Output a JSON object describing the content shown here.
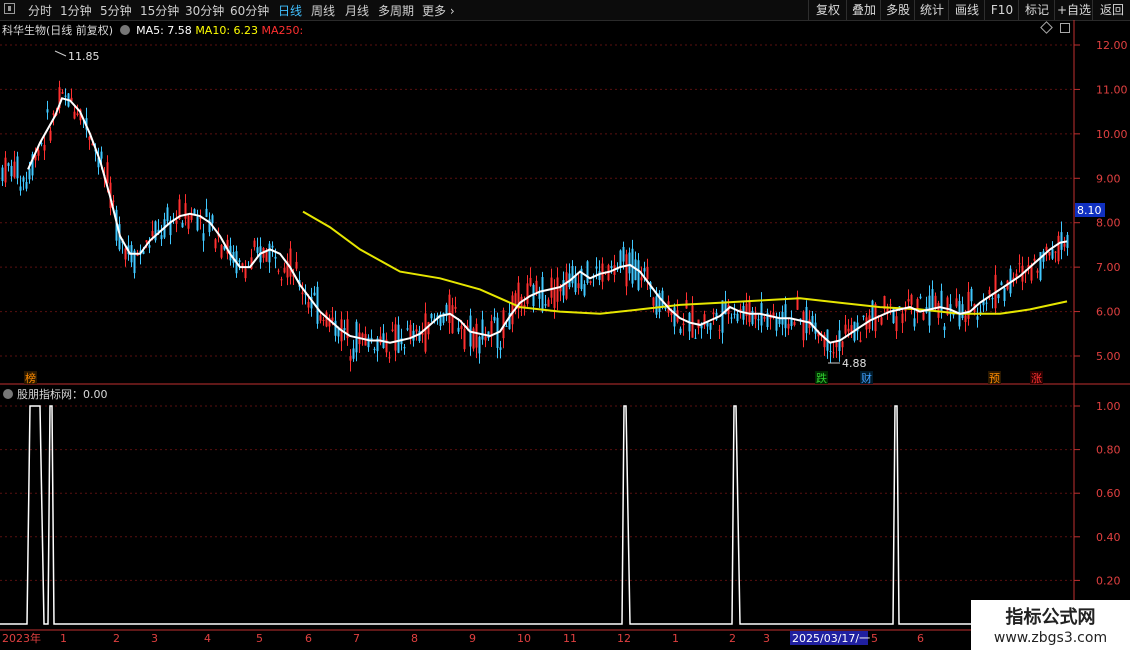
{
  "toolbar": {
    "periods": [
      "分时",
      "1分钟",
      "5分钟",
      "15分钟",
      "30分钟",
      "60分钟",
      "日线",
      "周线",
      "月线",
      "多周期",
      "更多"
    ],
    "active_period": "日线",
    "right_buttons": [
      "复权",
      "叠加",
      "多股",
      "统计",
      "画线",
      "F10",
      "标记",
      "+自选",
      "返回"
    ]
  },
  "main_panel": {
    "stock_title": "科华生物(日线 前复权)",
    "ma5_label": "MA5: 7.58",
    "ma10_label": "MA10: 6.23",
    "ma250_label": "MA250:",
    "colors": {
      "ma5": "#ffffff",
      "ma10": "#ffff00",
      "ma250": "#ff3030",
      "up": "#ff3030",
      "down": "#40c8ff"
    },
    "current_price_tag": "8.10",
    "high_annotation": "11.85",
    "low_annotation": "4.88",
    "event_markers": [
      {
        "text": "榜",
        "color": "#ff8c00"
      },
      {
        "text": "跌",
        "color": "#30d030"
      },
      {
        "text": "财",
        "color": "#40a0ff"
      },
      {
        "text": "预",
        "color": "#ff8c00"
      },
      {
        "text": "涨",
        "color": "#ff3030"
      }
    ]
  },
  "indicator_panel": {
    "title": "股朋指标网：0.00",
    "spike_count": 5
  },
  "time_axis": {
    "labels": [
      "2023年",
      "1",
      "2",
      "3",
      "4",
      "5",
      "6",
      "7",
      "8",
      "9",
      "10",
      "11",
      "12",
      "1",
      "2",
      "3",
      "2025/03/17/一",
      "5",
      "6"
    ]
  },
  "watermark": {
    "line1": "指标公式网",
    "line2": "www.zbgs3.com"
  },
  "chart_data": [
    {
      "type": "candlestick",
      "title": "科华生物(日线 前复权)",
      "ylim": [
        4.5,
        12.5
      ],
      "y_ticks": [
        "12.00",
        "11.00",
        "10.00",
        "9.00",
        "8.00",
        "7.00",
        "6.00",
        "5.00"
      ],
      "y_tick_values": [
        12,
        11,
        10,
        9,
        8,
        7,
        6,
        5
      ],
      "series": [
        {
          "name": "MA5",
          "x": [
            28,
            40,
            55,
            62,
            70,
            80,
            90,
            100,
            110,
            120,
            130,
            140,
            150,
            160,
            170,
            180,
            190,
            200,
            210,
            220,
            230,
            240,
            250,
            260,
            270,
            280,
            290,
            300,
            310,
            320,
            330,
            340,
            350,
            360,
            370,
            380,
            390,
            400,
            410,
            420,
            430,
            440,
            450,
            460,
            470,
            480,
            490,
            500,
            510,
            520,
            530,
            540,
            550,
            560,
            570,
            580,
            590,
            600,
            610,
            620,
            630,
            640,
            650,
            660,
            670,
            680,
            690,
            700,
            710,
            720,
            730,
            740,
            750,
            760,
            770,
            780,
            790,
            800,
            810,
            820,
            830,
            840,
            850,
            860,
            870,
            880,
            890,
            900,
            910,
            920,
            930,
            940,
            950,
            960,
            970,
            980,
            990,
            1000,
            1010,
            1020,
            1030,
            1040,
            1050,
            1060,
            1067
          ],
          "values": [
            9.2,
            9.8,
            10.4,
            10.8,
            10.75,
            10.5,
            10.0,
            9.4,
            8.6,
            7.7,
            7.3,
            7.3,
            7.6,
            7.8,
            8.0,
            8.15,
            8.2,
            8.15,
            8.0,
            7.7,
            7.3,
            7.0,
            7.0,
            7.3,
            7.4,
            7.3,
            7.0,
            6.6,
            6.3,
            6.0,
            5.8,
            5.6,
            5.45,
            5.4,
            5.35,
            5.35,
            5.3,
            5.35,
            5.4,
            5.5,
            5.7,
            5.9,
            5.95,
            5.8,
            5.55,
            5.5,
            5.45,
            5.55,
            5.9,
            6.2,
            6.35,
            6.45,
            6.5,
            6.55,
            6.7,
            6.9,
            6.75,
            6.85,
            6.9,
            7.0,
            7.05,
            6.9,
            6.6,
            6.3,
            6.05,
            5.85,
            5.75,
            5.7,
            5.8,
            5.9,
            6.1,
            6.0,
            5.95,
            5.95,
            5.9,
            5.85,
            5.85,
            5.8,
            5.75,
            5.5,
            5.3,
            5.35,
            5.5,
            5.65,
            5.8,
            5.9,
            6.0,
            6.05,
            6.1,
            6.0,
            6.05,
            6.1,
            6.05,
            5.95,
            6.0,
            6.2,
            6.35,
            6.5,
            6.65,
            6.8,
            7.0,
            7.2,
            7.4,
            7.55,
            7.58
          ]
        },
        {
          "name": "MA10",
          "x": [
            303,
            330,
            360,
            400,
            440,
            480,
            520,
            560,
            600,
            640,
            680,
            720,
            760,
            800,
            840,
            880,
            920,
            960,
            1000,
            1030,
            1067
          ],
          "values": [
            8.25,
            7.9,
            7.4,
            6.9,
            6.75,
            6.5,
            6.1,
            6.0,
            5.95,
            6.05,
            6.15,
            6.2,
            6.25,
            6.3,
            6.2,
            6.1,
            6.05,
            5.95,
            5.95,
            6.05,
            6.23
          ]
        }
      ]
    },
    {
      "type": "line",
      "title": "股朋指标网：0.00",
      "ylim": [
        0,
        1.1
      ],
      "y_ticks": [
        "1.00",
        "0.80",
        "0.60",
        "0.40",
        "0.20"
      ],
      "y_tick_values": [
        1.0,
        0.8,
        0.6,
        0.4,
        0.2
      ],
      "series": [
        {
          "name": "股朋指标网",
          "x": [
            0,
            27,
            30,
            40,
            44,
            48,
            50,
            52,
            54,
            622,
            624,
            626,
            630,
            633,
            732,
            734,
            736,
            740,
            742,
            893,
            895,
            897,
            899,
            901,
            1074
          ],
          "values": [
            0,
            0,
            1,
            1,
            0,
            0,
            1,
            1,
            0,
            0,
            1,
            1,
            0,
            0,
            0,
            1,
            1,
            0,
            0,
            0,
            1,
            1,
            0,
            0,
            0
          ]
        }
      ]
    }
  ]
}
